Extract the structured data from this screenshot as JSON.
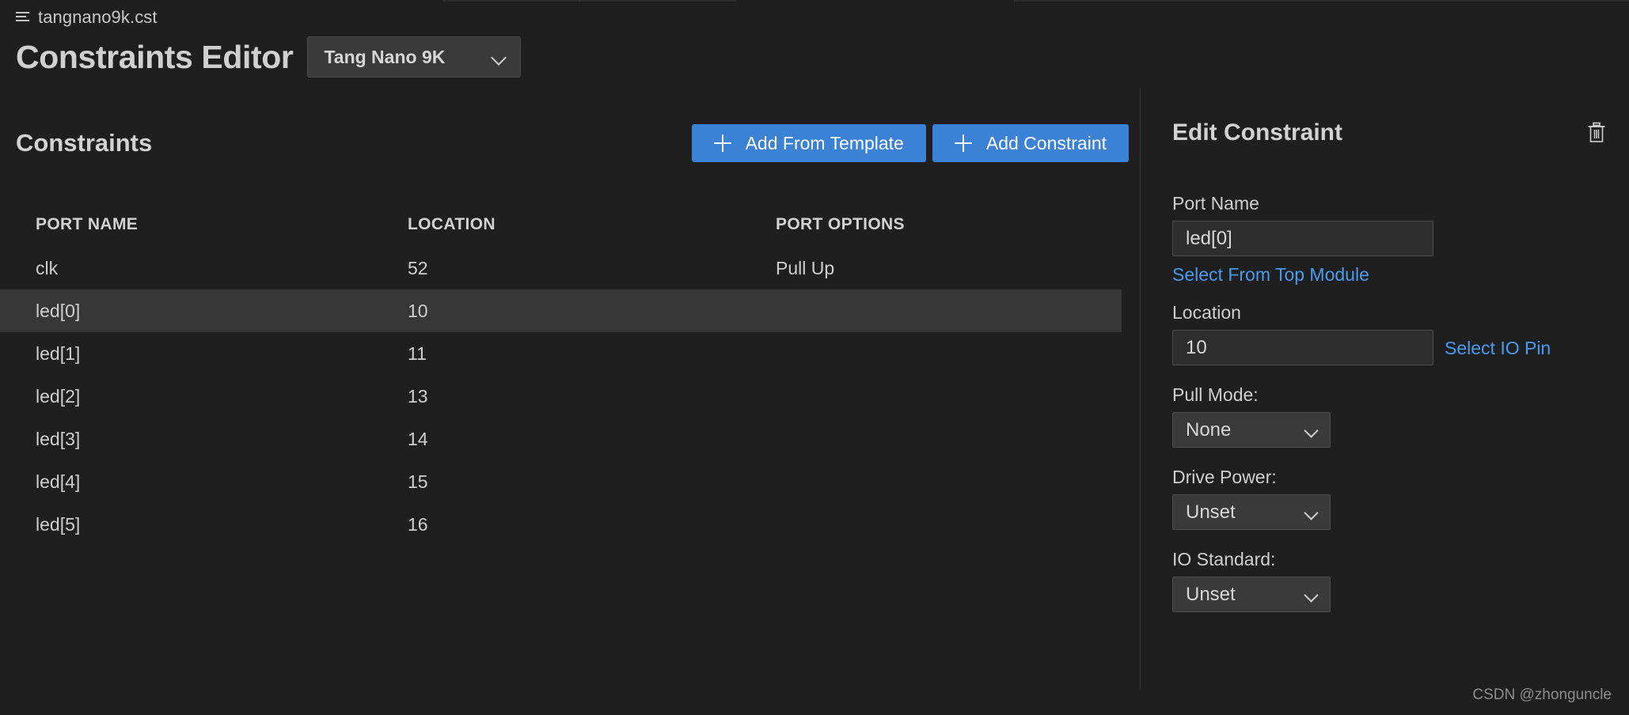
{
  "breadcrumb": {
    "icon": "list-icon",
    "file": "tangnano9k.cst"
  },
  "header": {
    "title": "Constraints Editor",
    "board_select": {
      "value": "Tang Nano 9K",
      "chevron": "chevron-down-icon"
    }
  },
  "left": {
    "section_title": "Constraints",
    "buttons": {
      "add_from_template": "Add From Template",
      "add_constraint": "Add Constraint",
      "plus_icon": "plus-icon"
    },
    "table": {
      "columns": [
        "PORT NAME",
        "LOCATION",
        "PORT OPTIONS"
      ],
      "rows": [
        {
          "port": "clk",
          "location": "52",
          "options": "Pull Up",
          "selected": false
        },
        {
          "port": "led[0]",
          "location": "10",
          "options": "",
          "selected": true
        },
        {
          "port": "led[1]",
          "location": "11",
          "options": "",
          "selected": false
        },
        {
          "port": "led[2]",
          "location": "13",
          "options": "",
          "selected": false
        },
        {
          "port": "led[3]",
          "location": "14",
          "options": "",
          "selected": false
        },
        {
          "port": "led[4]",
          "location": "15",
          "options": "",
          "selected": false
        },
        {
          "port": "led[5]",
          "location": "16",
          "options": "",
          "selected": false
        }
      ]
    }
  },
  "right": {
    "title": "Edit Constraint",
    "delete_icon": "trash-icon",
    "port_name": {
      "label": "Port Name",
      "value": "led[0]",
      "link": "Select From Top Module"
    },
    "location": {
      "label": "Location",
      "value": "10",
      "link": "Select IO Pin"
    },
    "pull_mode": {
      "label": "Pull Mode:",
      "value": "None"
    },
    "drive_power": {
      "label": "Drive Power:",
      "value": "Unset"
    },
    "io_standard": {
      "label": "IO Standard:",
      "value": "Unset"
    }
  },
  "watermark": "CSDN @zhonguncle",
  "colors": {
    "background": "#1f1f1f",
    "accent_blue": "#3b82d6",
    "link_blue": "#4a9bf0",
    "row_selected": "#373737",
    "text": "#cfcfcf"
  }
}
